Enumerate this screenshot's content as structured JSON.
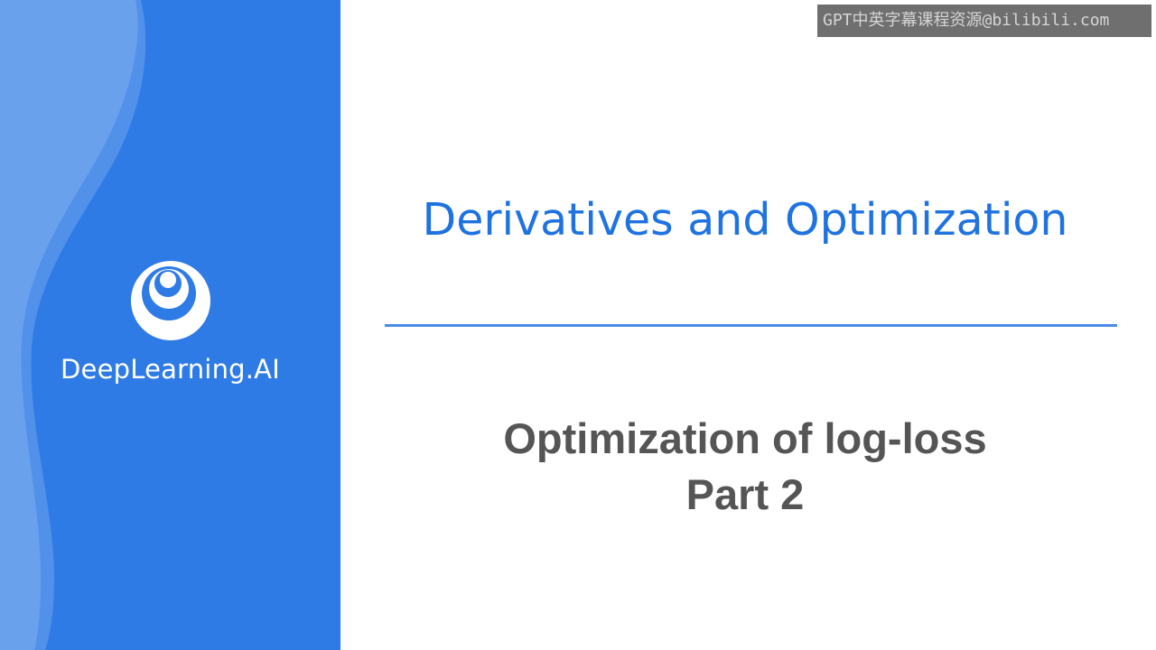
{
  "brand": {
    "name": "DeepLearning.AI",
    "logo_icon": "concentric-circles-logo-icon"
  },
  "watermark": {
    "text": "GPT中英字幕课程资源@bilibili.com"
  },
  "slide": {
    "title": "Derivatives and Optimization",
    "subtitle_line1": "Optimization of log-loss",
    "subtitle_line2": "Part 2"
  },
  "colors": {
    "panel_blue": "#2f7be6",
    "title_blue": "#1f73e0",
    "divider_blue": "#4a8ae8",
    "subtitle_gray": "#555555",
    "watermark_bg": "#6f6f6f"
  }
}
